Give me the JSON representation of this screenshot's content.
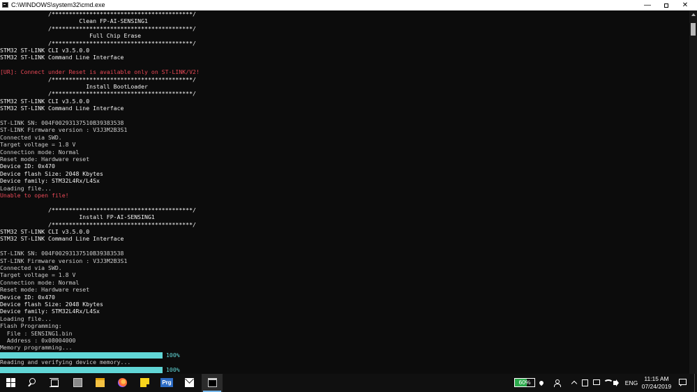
{
  "window": {
    "title": "C:\\WINDOWS\\system32\\cmd.exe",
    "minimize": "—",
    "close": "✕"
  },
  "console": {
    "lines": [
      {
        "text": "              /*****************************************/",
        "style": "bright"
      },
      {
        "text": "                       Clean FP-AI-SENSING1",
        "style": "bright"
      },
      {
        "text": "              /*****************************************/",
        "style": "bright"
      },
      {
        "text": "                          Full Chip Erase",
        "style": "bright"
      },
      {
        "text": "              /*****************************************/",
        "style": "bright"
      },
      {
        "text": "STM32 ST-LINK CLI v3.5.0.0",
        "style": "bright"
      },
      {
        "text": "STM32 ST-LINK Command Line Interface",
        "style": "bright"
      },
      {
        "text": "",
        "style": ""
      },
      {
        "text": "[UR]: Connect under Reset is available only on ST-LINK/V2!",
        "style": "red"
      },
      {
        "text": "              /*****************************************/",
        "style": "bright"
      },
      {
        "text": "                         Install BootLoader",
        "style": "bright"
      },
      {
        "text": "              /*****************************************/",
        "style": "bright"
      },
      {
        "text": "STM32 ST-LINK CLI v3.5.0.0",
        "style": "bright"
      },
      {
        "text": "STM32 ST-LINK Command Line Interface",
        "style": "bright"
      },
      {
        "text": "",
        "style": ""
      },
      {
        "text": "ST-LINK SN: 004F00293137510B39383538",
        "style": ""
      },
      {
        "text": "ST-LINK Firmware version : V3J3M2B3S1",
        "style": ""
      },
      {
        "text": "Connected via SWD.",
        "style": ""
      },
      {
        "text": "Target voltage = 1.8 V",
        "style": ""
      },
      {
        "text": "Connection mode: Normal",
        "style": ""
      },
      {
        "text": "Reset mode: Hardware reset",
        "style": ""
      },
      {
        "text": "Device ID: 0x470",
        "style": "bright"
      },
      {
        "text": "Device flash Size: 2048 Kbytes",
        "style": "bright"
      },
      {
        "text": "Device family: STM32L4Rx/L4Sx",
        "style": "bright"
      },
      {
        "text": "Loading file...",
        "style": ""
      },
      {
        "text": "Unable to open file!",
        "style": "red"
      },
      {
        "text": "",
        "style": ""
      },
      {
        "text": "              /*****************************************/",
        "style": "bright"
      },
      {
        "text": "                       Install FP-AI-SENSING1",
        "style": "bright"
      },
      {
        "text": "              /*****************************************/",
        "style": "bright"
      },
      {
        "text": "STM32 ST-LINK CLI v3.5.0.0",
        "style": "bright"
      },
      {
        "text": "STM32 ST-LINK Command Line Interface",
        "style": "bright"
      },
      {
        "text": "",
        "style": ""
      },
      {
        "text": "ST-LINK SN: 004F00293137510B39383538",
        "style": ""
      },
      {
        "text": "ST-LINK Firmware version : V3J3M2B3S1",
        "style": ""
      },
      {
        "text": "Connected via SWD.",
        "style": ""
      },
      {
        "text": "Target voltage = 1.8 V",
        "style": ""
      },
      {
        "text": "Connection mode: Normal",
        "style": ""
      },
      {
        "text": "Reset mode: Hardware reset",
        "style": ""
      },
      {
        "text": "Device ID: 0x470",
        "style": "bright"
      },
      {
        "text": "Device flash Size: 2048 Kbytes",
        "style": "bright"
      },
      {
        "text": "Device family: STM32L4Rx/L4Sx",
        "style": "bright"
      },
      {
        "text": "Loading file...",
        "style": ""
      },
      {
        "text": "Flash Programming:",
        "style": ""
      },
      {
        "text": "  File : SENSING1.bin",
        "style": ""
      },
      {
        "text": "  Address : 0x08004000",
        "style": ""
      },
      {
        "text": "Memory programming...",
        "style": ""
      },
      {
        "progress": 1.0,
        "label": "100%"
      },
      {
        "text": "Reading and verifying device memory...",
        "style": ""
      },
      {
        "progress": 1.0,
        "label": "100%"
      }
    ]
  },
  "taskbar": {
    "battery": {
      "label": "60%",
      "level": 0.6
    },
    "language": "ENG",
    "time": "11:15 AM",
    "date": "07/24/2019",
    "prg_label": "Prg",
    "colors": {
      "accent": "#76b9ed",
      "progress": "#61d6d6",
      "error": "#e74856"
    }
  }
}
